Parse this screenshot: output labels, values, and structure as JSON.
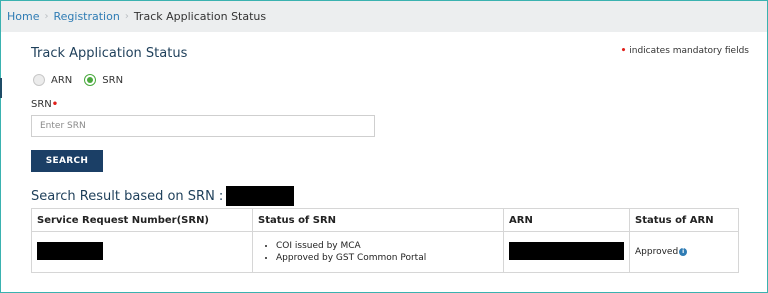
{
  "breadcrumb": {
    "items": [
      {
        "label": "Home"
      },
      {
        "label": "Registration"
      },
      {
        "label": "Track Application Status"
      }
    ]
  },
  "form": {
    "title": "Track Application Status",
    "mandatory_note": "indicates mandatory fields",
    "required_mark": "•",
    "radio_options": [
      {
        "label": "ARN",
        "selected": false
      },
      {
        "label": "SRN",
        "selected": true
      }
    ],
    "srn_label": "SRN",
    "srn_placeholder": "Enter SRN",
    "srn_value": "",
    "search_label": "SEARCH"
  },
  "results": {
    "heading": "Search Result based on SRN :",
    "columns": [
      "Service Request Number(SRN)",
      "Status of SRN",
      "ARN",
      "Status of ARN"
    ],
    "rows": [
      {
        "srn_status": [
          "COI issued by MCA",
          "Approved by GST Common Portal"
        ],
        "arn_status": "Approved"
      }
    ]
  },
  "colors": {
    "accent": "#1b3f66",
    "link": "#2f7cb4",
    "required": "#e0201b",
    "radio_selected": "#4aa93e",
    "frame_border": "#3ab2b0"
  },
  "icons": {
    "info": "info-icon"
  }
}
